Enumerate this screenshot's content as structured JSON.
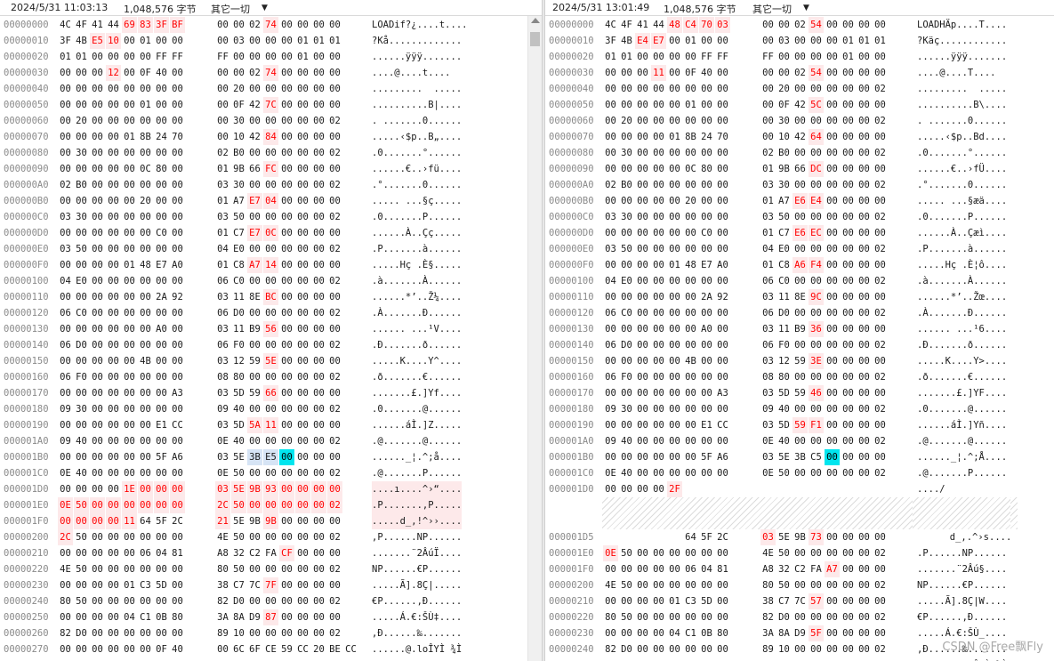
{
  "left": {
    "header": {
      "date": "2024/5/31 11:03:13",
      "size": "1,048,576 字节",
      "filter": "其它一切",
      "caret": "▼"
    },
    "rows": [
      [
        "00000000",
        "4C 4F 41 44 69 83 3F BF 00 00 02 74 00 00 00 00",
        "LOADif?¿....t....",
        "4,5,6,7,11"
      ],
      [
        "00000010",
        "3F 4B E5 10 00 01 00 00 00 03 00 00 00 01 01 01",
        "?Kå.............",
        "2,3"
      ],
      [
        "00000020",
        "01 01 00 00 00 00 FF FF FF 00 00 00 00 01 00 00",
        "......ÿÿÿ.......",
        ""
      ],
      [
        "00000030",
        "00 00 00 12 00 0F 40 00 00 00 02 74 00 00 00 00",
        "....@....t....",
        "3,11"
      ],
      [
        "00000040",
        "00 00 00 00 00 00 00 00 00 20 00 00 00 00 00 00",
        ".........  .....",
        ""
      ],
      [
        "00000050",
        "00 00 00 00 00 01 00 00 00 0F 42 7C 00 00 00 00",
        "..........B|....",
        "11"
      ],
      [
        "00000060",
        "00 20 00 00 00 00 00 00 00 30 00 00 00 00 00 02",
        ". .......0......",
        ""
      ],
      [
        "00000070",
        "00 00 00 00 01 8B 24 70 00 10 42 84 00 00 00 00",
        ".....‹$p..B„....",
        "11"
      ],
      [
        "00000080",
        "00 30 00 00 00 00 00 00 02 B0 00 00 00 00 00 02",
        ".0.......°......",
        ""
      ],
      [
        "00000090",
        "00 00 00 00 00 0C 80 00 01 9B 66 FC 00 00 00 00",
        "......€..›fü....",
        "11"
      ],
      [
        "000000A0",
        "02 B0 00 00 00 00 00 00 03 30 00 00 00 00 00 02",
        ".°.......0......",
        ""
      ],
      [
        "000000B0",
        "00 00 00 00 00 20 00 00 01 A7 E7 04 00 00 00 00",
        "..... ...§ç.....",
        "10,11"
      ],
      [
        "000000C0",
        "03 30 00 00 00 00 00 00 03 50 00 00 00 00 00 02",
        ".0.......P......",
        ""
      ],
      [
        "000000D0",
        "00 00 00 00 00 00 C0 00 01 C7 E7 0C 00 00 00 00",
        "......À..Çç.....",
        "10,11"
      ],
      [
        "000000E0",
        "03 50 00 00 00 00 00 00 04 E0 00 00 00 00 00 02",
        ".P.......à......",
        ""
      ],
      [
        "000000F0",
        "00 00 00 00 01 48 E7 A0 01 C8 A7 14 00 00 00 00",
        ".....Hç .È§.....",
        "10,11"
      ],
      [
        "00000100",
        "04 E0 00 00 00 00 00 00 06 C0 00 00 00 00 00 02",
        ".à.......À......",
        ""
      ],
      [
        "00000110",
        "00 00 00 00 00 00 2A 92 03 11 8E BC 00 00 00 00",
        "......*’..Ž¼....",
        "11"
      ],
      [
        "00000120",
        "06 C0 00 00 00 00 00 00 06 D0 00 00 00 00 00 02",
        ".À.......Ð......",
        ""
      ],
      [
        "00000130",
        "00 00 00 00 00 00 A0 00 03 11 B9 56 00 00 00 00",
        "...... ...¹V....",
        "11"
      ],
      [
        "00000140",
        "06 D0 00 00 00 00 00 00 06 F0 00 00 00 00 00 02",
        ".Ð.......ð......",
        ""
      ],
      [
        "00000150",
        "00 00 00 00 00 4B 00 00 03 12 59 5E 00 00 00 00",
        ".....K....Y^....",
        "11"
      ],
      [
        "00000160",
        "06 F0 00 00 00 00 00 00 08 80 00 00 00 00 00 02",
        ".ð.......€......",
        ""
      ],
      [
        "00000170",
        "00 00 00 00 00 00 00 A3 03 5D 59 66 00 00 00 00",
        ".......£.]Yf....",
        "11"
      ],
      [
        "00000180",
        "09 30 00 00 00 00 00 00 09 40 00 00 00 00 00 02",
        ".0.......@......",
        ""
      ],
      [
        "00000190",
        "00 00 00 00 00 00 E1 CC 03 5D 5A 11 00 00 00 00",
        "......áÌ.]Z.....",
        "10,11"
      ],
      [
        "000001A0",
        "09 40 00 00 00 00 00 00 0E 40 00 00 00 00 00 02",
        ".@.......@......",
        ""
      ],
      [
        "000001B0",
        "00 00 00 00 00 00 5F A6 03 5E 3B E5 00 00 00 00",
        "......_¦.^;å....",
        "C12"
      ],
      [
        "000001C0",
        "0E 40 00 00 00 00 00 00 0E 50 00 00 00 00 00 02",
        ".@.......P......",
        ""
      ],
      [
        "000001D0",
        "00 00 00 00 1E 00 00 00 03 5E 9B 93 00 00 00 00",
        "....ı....^›“....",
        "4,5,6,7,8,9,10,11,12,13,14,15"
      ],
      [
        "000001E0",
        "0E 50 00 00 00 00 00 00 2C 50 00 00 00 00 00 02",
        ".P.......,P.....",
        "0,1,2,3,4,5,6,7,8,9,10,11,12,13,14,15"
      ],
      [
        "000001F0",
        "00 00 00 00 11 64 5F 2C 21 5E 9B 9B 00 00 00 00",
        ".....d_,!^››....",
        "0,1,2,3,4,8,11"
      ],
      [
        "00000200",
        "2C 50 00 00 00 00 00 00 4E 50 00 00 00 00 00 02",
        ",P......NP......",
        "0"
      ],
      [
        "00000210",
        "00 00 00 00 00 06 04 81 A8 32 C2 FA CF 00 00 00",
        ".......¨2ÂúÏ....",
        "12"
      ],
      [
        "00000220",
        "4E 50 00 00 00 00 00 00 80 50 00 00 00 00 00 02",
        "NP......€P......",
        ""
      ],
      [
        "00000230",
        "00 00 00 00 01 C3 5D 00 38 C7 7C 7F 00 00 00 00",
        ".....Ã].8Ç|.....",
        "11"
      ],
      [
        "00000240",
        "80 50 00 00 00 00 00 00 82 D0 00 00 00 00 00 02",
        "€P......‚Ð......",
        ""
      ],
      [
        "00000250",
        "00 00 00 00 04 C1 0B 80 3A 8A D9 87 00 00 00 00",
        ".....Á.€:ŠÙ‡....",
        "11"
      ],
      [
        "00000260",
        "82 D0 00 00 00 00 00 00 89 10 00 00 00 00 00 02",
        "‚Ð......‰.......",
        ""
      ],
      [
        "00000270",
        "00 00 00 00 00 00 0F 40 00 6C 6F CE 59 CC 20 BE CC",
        "......@.loÎYÌ ¾Ì",
        ""
      ]
    ]
  },
  "right": {
    "header": {
      "date": "2024/5/31 13:01:49",
      "size": "1,048,576 字节",
      "filter": "其它一切",
      "caret": "▼"
    },
    "rows": [
      [
        "00000000",
        "4C 4F 41 44 48 C4 70 03 00 00 02 54 00 00 00 00",
        "LOADHÄp....T....",
        "4,5,6,7,11"
      ],
      [
        "00000010",
        "3F 4B E4 E7 00 01 00 00 00 03 00 00 00 01 01 01",
        "?Käç............",
        "2,3"
      ],
      [
        "00000020",
        "01 01 00 00 00 00 FF FF FF 00 00 00 00 01 00 00",
        "......ÿÿÿ.......",
        ""
      ],
      [
        "00000030",
        "00 00 00 11 00 0F 40 00 00 00 02 54 00 00 00 00",
        "....@....T....",
        "3,11"
      ],
      [
        "00000040",
        "00 00 00 00 00 00 00 00 00 20 00 00 00 00 00 02",
        ".........  .....",
        ""
      ],
      [
        "00000050",
        "00 00 00 00 00 01 00 00 00 0F 42 5C 00 00 00 00",
        "..........B\\....",
        "11"
      ],
      [
        "00000060",
        "00 20 00 00 00 00 00 00 00 30 00 00 00 00 00 02",
        ". .......0......",
        ""
      ],
      [
        "00000070",
        "00 00 00 00 01 8B 24 70 00 10 42 64 00 00 00 00",
        ".....‹$p..Bd....",
        "11"
      ],
      [
        "00000080",
        "00 30 00 00 00 00 00 00 02 B0 00 00 00 00 00 02",
        ".0.......°......",
        ""
      ],
      [
        "00000090",
        "00 00 00 00 00 0C 80 00 01 9B 66 DC 00 00 00 00",
        "......€..›fÜ....",
        "11"
      ],
      [
        "000000A0",
        "02 B0 00 00 00 00 00 00 03 30 00 00 00 00 00 02",
        ".°.......0......",
        ""
      ],
      [
        "000000B0",
        "00 00 00 00 00 20 00 00 01 A7 E6 E4 00 00 00 00",
        "..... ...§æä....",
        "10,11"
      ],
      [
        "000000C0",
        "03 30 00 00 00 00 00 00 03 50 00 00 00 00 00 02",
        ".0.......P......",
        ""
      ],
      [
        "000000D0",
        "00 00 00 00 00 00 C0 00 01 C7 E6 EC 00 00 00 00",
        "......À..Çæì....",
        "10,11"
      ],
      [
        "000000E0",
        "03 50 00 00 00 00 00 00 04 E0 00 00 00 00 00 02",
        ".P.......à......",
        ""
      ],
      [
        "000000F0",
        "00 00 00 00 01 48 E7 A0 01 C8 A6 F4 00 00 00 00",
        ".....Hç .È¦ô....",
        "10,11"
      ],
      [
        "00000100",
        "04 E0 00 00 00 00 00 00 06 C0 00 00 00 00 00 02",
        ".à.......À......",
        ""
      ],
      [
        "00000110",
        "00 00 00 00 00 00 2A 92 03 11 8E 9C 00 00 00 00",
        "......*’..Žœ....",
        "11"
      ],
      [
        "00000120",
        "06 C0 00 00 00 00 00 00 06 D0 00 00 00 00 00 02",
        ".À.......Ð......",
        ""
      ],
      [
        "00000130",
        "00 00 00 00 00 00 A0 00 03 11 B9 36 00 00 00 00",
        "...... ...¹6....",
        "11"
      ],
      [
        "00000140",
        "06 D0 00 00 00 00 00 00 06 F0 00 00 00 00 00 02",
        ".Ð.......ð......",
        ""
      ],
      [
        "00000150",
        "00 00 00 00 00 4B 00 00 03 12 59 3E 00 00 00 00",
        ".....K....Y>....",
        "11"
      ],
      [
        "00000160",
        "06 F0 00 00 00 00 00 00 08 80 00 00 00 00 00 02",
        ".ð.......€......",
        ""
      ],
      [
        "00000170",
        "00 00 00 00 00 00 00 A3 03 5D 59 46 00 00 00 00",
        ".......£.]YF....",
        "11"
      ],
      [
        "00000180",
        "09 30 00 00 00 00 00 00 09 40 00 00 00 00 00 02",
        ".0.......@......",
        ""
      ],
      [
        "00000190",
        "00 00 00 00 00 00 E1 CC 03 5D 59 F1 00 00 00 00",
        "......áÌ.]Yñ....",
        "10,11"
      ],
      [
        "000001A0",
        "09 40 00 00 00 00 00 00 0E 40 00 00 00 00 00 02",
        ".@.......@......",
        ""
      ],
      [
        "000001B0",
        "00 00 00 00 00 00 5F A6 03 5E 3B C5 00 00 00 00",
        "......_¦.^;Å....",
        "C12"
      ],
      [
        "000001C0",
        "0E 40 00 00 00 00 00 00 0E 50 00 00 00 00 00 02",
        ".@.......P......",
        ""
      ],
      [
        "000001D0",
        "00 00 00 00 2F",
        "..../",
        "4"
      ],
      [
        "GAP"
      ],
      [
        "000001D5",
        "64 5F 2C 03 5E 9B 73 00 00 00 00",
        "d_,.^›s....",
        "3,6"
      ],
      [
        "000001E0",
        "0E 50 00 00 00 00 00 00 4E 50 00 00 00 00 00 02",
        ".P......NP......",
        "0"
      ],
      [
        "000001F0",
        "00 00 00 00 00 06 04 81 A8 32 C2 FA A7 00 00 00",
        ".......¨2Âú§....",
        "12"
      ],
      [
        "00000200",
        "4E 50 00 00 00 00 00 00 80 50 00 00 00 00 00 02",
        "NP......€P......",
        ""
      ],
      [
        "00000210",
        "00 00 00 00 01 C3 5D 00 38 C7 7C 57 00 00 00 00",
        ".....Ã].8Ç|W....",
        "11"
      ],
      [
        "00000220",
        "80 50 00 00 00 00 00 00 82 D0 00 00 00 00 00 02",
        "€P......‚Ð......",
        ""
      ],
      [
        "00000230",
        "00 00 00 00 04 C1 0B 80 3A 8A D9 5F 00 00 00 00",
        ".....Á.€:ŠÙ_....",
        "11"
      ],
      [
        "00000240",
        "82 D0 00 00 00 00 00 00 89 10 00 00 00 00 00 02",
        "‚Ð......‰.......",
        ""
      ],
      [
        "00000250",
        "00 00 00 00 00 00 0F 40 00 6C 6F CE 59 CC 20 BE CC",
        "......@.loÎYÌ ¾Ì",
        ""
      ]
    ]
  },
  "watermark": "CSDN @Free飘Fly"
}
